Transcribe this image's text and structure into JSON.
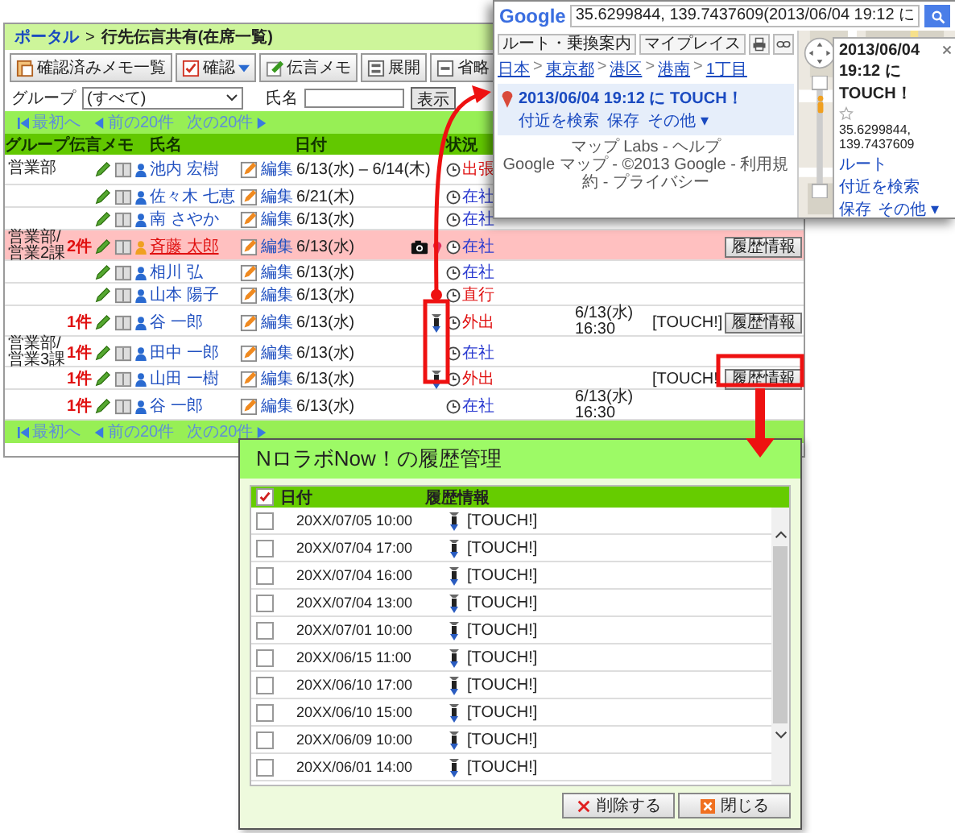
{
  "main": {
    "breadcrumb_link": "ポータル",
    "separator": ">",
    "title": "行先伝言共有(在席一覧)",
    "toolbar": [
      {
        "label": "確認済みメモ一覧",
        "kind": "memo",
        "dropdown": false
      },
      {
        "label": "確認",
        "kind": "check",
        "dropdown": true
      },
      {
        "label": "伝言メモ",
        "kind": "note",
        "dropdown": false
      },
      {
        "label": "展開",
        "kind": "expand",
        "dropdown": false
      },
      {
        "label": "省略",
        "kind": "collapse",
        "dropdown": false
      }
    ],
    "filter": {
      "group_label": "グループ",
      "group_value": "(すべて)",
      "name_label": "氏名",
      "submit": "表示"
    },
    "pager_top": {
      "first": "最初へ",
      "prev": "前の20件",
      "next": "次の20件"
    },
    "columns": [
      "グループ",
      "伝言メモ",
      "氏名",
      "日付",
      "状況"
    ],
    "rows": [
      {
        "group": "営業部",
        "name": "池内 宏樹",
        "edit": "編集",
        "date": "6/13(水) – 6/14(木)",
        "highlighted": false,
        "camera": false,
        "pin": false,
        "touch": false,
        "status": "出張",
        "away": true
      },
      {
        "name": "佐々木 七恵",
        "edit": "編集",
        "date": "6/21(木)",
        "highlighted": false,
        "camera": false,
        "pin": false,
        "touch": false,
        "status": "在社",
        "away": false
      },
      {
        "name": "南 さやか",
        "edit": "編集",
        "date": "6/13(水)",
        "highlighted": false,
        "camera": false,
        "pin": false,
        "touch": false,
        "status": "在社",
        "away": false
      },
      {
        "group": "営業部/営業2課",
        "memo_count": "2件",
        "name": "斉藤 太郎",
        "edit": "編集",
        "date": "6/13(水)",
        "highlighted": true,
        "camera": true,
        "pin": true,
        "touch": false,
        "status": "在社",
        "away": false,
        "history_button": "履歴情報"
      },
      {
        "name": "相川 弘",
        "edit": "編集",
        "date": "6/13(水)",
        "highlighted": false,
        "camera": false,
        "pin": false,
        "touch": false,
        "status": "在社",
        "away": false
      },
      {
        "name": "山本 陽子",
        "edit": "編集",
        "date": "6/13(水)",
        "highlighted": false,
        "camera": false,
        "pin": false,
        "touch": false,
        "status": "直行",
        "away": true
      },
      {
        "memo_count": "1件",
        "name": "谷 一郎",
        "edit": "編集",
        "date": "6/13(水)",
        "highlighted": false,
        "camera": false,
        "pin": false,
        "touch": true,
        "status": "外出",
        "away": true,
        "seen_date": "6/13(水)",
        "seen_time": "16:30",
        "touch_label": "[TOUCH!]",
        "history_button": "履歴情報"
      },
      {
        "group": "営業部/営業3課",
        "memo_count": "1件",
        "name": "田中 一郎",
        "edit": "編集",
        "date": "6/13(水)",
        "highlighted": false,
        "camera": false,
        "pin": false,
        "touch": false,
        "status": "在社",
        "away": false
      },
      {
        "memo_count": "1件",
        "name": "山田 一樹",
        "edit": "編集",
        "date": "6/13(水)",
        "highlighted": false,
        "camera": false,
        "pin": false,
        "touch": true,
        "status": "外出",
        "away": true,
        "touch_label": "[TOUCH!",
        "history_button": "履歴情報"
      },
      {
        "memo_count": "1件",
        "name": "谷 一郎",
        "edit": "編集",
        "date": "6/13(水)",
        "highlighted": false,
        "camera": false,
        "pin": false,
        "touch": false,
        "status": "在社",
        "away": false,
        "seen_date": "6/13(水)",
        "seen_time": "16:30"
      }
    ],
    "pager_bottom": {
      "first": "最初へ",
      "prev": "前の20件",
      "next": "次の20件"
    }
  },
  "map_window": {
    "logo": "Google",
    "search_value": "35.6299844, 139.7437609(2013/06/04 19:12 に",
    "buttons": [
      "ルート・乗換案内",
      "マイプレイス"
    ],
    "breadcrumb": [
      "日本",
      "東京都",
      "港区",
      "港南",
      "1丁目"
    ],
    "breadcrumb_separator": ">",
    "result_title": "2013/06/04 19:12 に TOUCH！",
    "result_links": [
      "付近を検索",
      "保存",
      "その他 ▾"
    ],
    "footer": [
      "マップ Labs - ヘルプ",
      "Google マップ - ©2013 Google - 利用規約 - プライバシー"
    ],
    "bubble": {
      "title": "2013/06/04 19:12 に TOUCH！",
      "coords": "35.6299844, 139.7437609",
      "links": [
        "ルート",
        "付近を検索",
        "保存",
        "その他 ▾"
      ]
    }
  },
  "dialog": {
    "title": "NロラボNow！の履歴管理",
    "header_checked": true,
    "columns": [
      "日付",
      "履歴情報"
    ],
    "rows": [
      {
        "date": "20XX/07/05 10:00",
        "info": "[TOUCH!]",
        "checked": false
      },
      {
        "date": "20XX/07/04 17:00",
        "info": "[TOUCH!]",
        "checked": false
      },
      {
        "date": "20XX/07/04 16:00",
        "info": "[TOUCH!]",
        "checked": false
      },
      {
        "date": "20XX/07/04 13:00",
        "info": "[TOUCH!]",
        "checked": false
      },
      {
        "date": "20XX/07/01 10:00",
        "info": "[TOUCH!]",
        "checked": false
      },
      {
        "date": "20XX/06/15 11:00",
        "info": "[TOUCH!]",
        "checked": false
      },
      {
        "date": "20XX/06/10 17:00",
        "info": "[TOUCH!]",
        "checked": false
      },
      {
        "date": "20XX/06/10 15:00",
        "info": "[TOUCH!]",
        "checked": false
      },
      {
        "date": "20XX/06/09 10:00",
        "info": "[TOUCH!]",
        "checked": false
      },
      {
        "date": "20XX/06/01 14:00",
        "info": "[TOUCH!]",
        "checked": false
      }
    ],
    "buttons": [
      {
        "label": "削除する",
        "kind": "delete"
      },
      {
        "label": "閉じる",
        "kind": "close"
      }
    ]
  }
}
